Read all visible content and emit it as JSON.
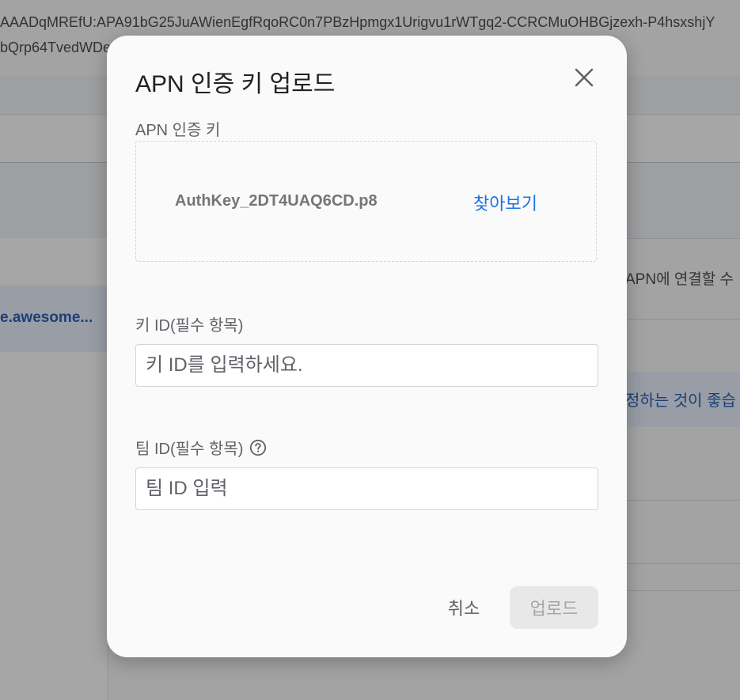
{
  "background": {
    "token_line_1": "AAADqMREfU:APA91bG25JuAWienEgfRqoRC0n7PBzHpmgx1Urigvu1rWTgq2-CCRCMuOHBGjzexh-P4hsxshjY",
    "token_line_2": "bQrp64TvedWDe",
    "left_item_label": "e.awesome...",
    "right_text": "APN에 연결할 수",
    "right_highlight_text": "정하는 것이 좋습"
  },
  "dialog": {
    "title": "APN 인증 키 업로드",
    "close_icon": "close-icon",
    "apn_key_label": "APN 인증 키",
    "file_name": "AuthKey_2DT4UAQ6CD.p8",
    "browse_label": "찾아보기",
    "key_id_label": "키 ID(필수 항목)",
    "key_id_placeholder": "키 ID를 입력하세요.",
    "key_id_value": "",
    "team_id_label": "팀 ID(필수 항목)",
    "team_id_help_icon": "help-circle-icon",
    "team_id_placeholder": "팀 ID 입력",
    "team_id_value": "",
    "cancel_label": "취소",
    "upload_label": "업로드",
    "upload_disabled": true
  },
  "colors": {
    "accent": "#1a73e8",
    "scrim": "#202124",
    "disabled_button": "#e8e8e8"
  }
}
